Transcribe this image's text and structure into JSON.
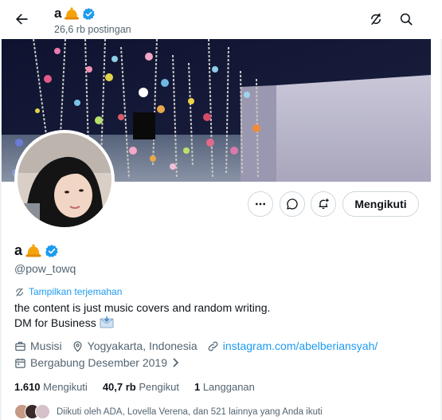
{
  "header": {
    "name": "a",
    "post_count": "26,6 rb postingan"
  },
  "profile": {
    "display_name": "a",
    "handle": "@pow_towq",
    "translate_label": "Tampilkan terjemahan",
    "bio_line1": "the content is just music covers and random writing.",
    "bio_line2": "DM for Business",
    "category": "Musisi",
    "location": "Yogyakarta, Indonesia",
    "website": "instagram.com/abelberiansyah/",
    "joined": "Bergabung Desember 2019",
    "follow_button": "Mengikuti"
  },
  "stats": {
    "following_count": "1.610",
    "following_label": "Mengikuti",
    "followers_count": "40,7 rb",
    "followers_label": "Pengikut",
    "subs_count": "1",
    "subs_label": "Langganan"
  },
  "followed_by": "Diikuti oleh ADA, Lovella Verena, dan 521 lainnya yang Anda ikuti",
  "colors": {
    "accent": "#1d9bf0",
    "text": "#0f1419",
    "secondary": "#536471"
  },
  "icons": [
    "back-arrow-icon",
    "verified-badge-icon",
    "bell-emoji-icon",
    "stop-notify-icon",
    "search-icon",
    "more-icon",
    "message-icon",
    "notification-add-icon",
    "translate-icon",
    "envelope-emoji-icon",
    "briefcase-icon",
    "location-pin-icon",
    "link-icon",
    "calendar-icon",
    "chevron-right-icon"
  ]
}
